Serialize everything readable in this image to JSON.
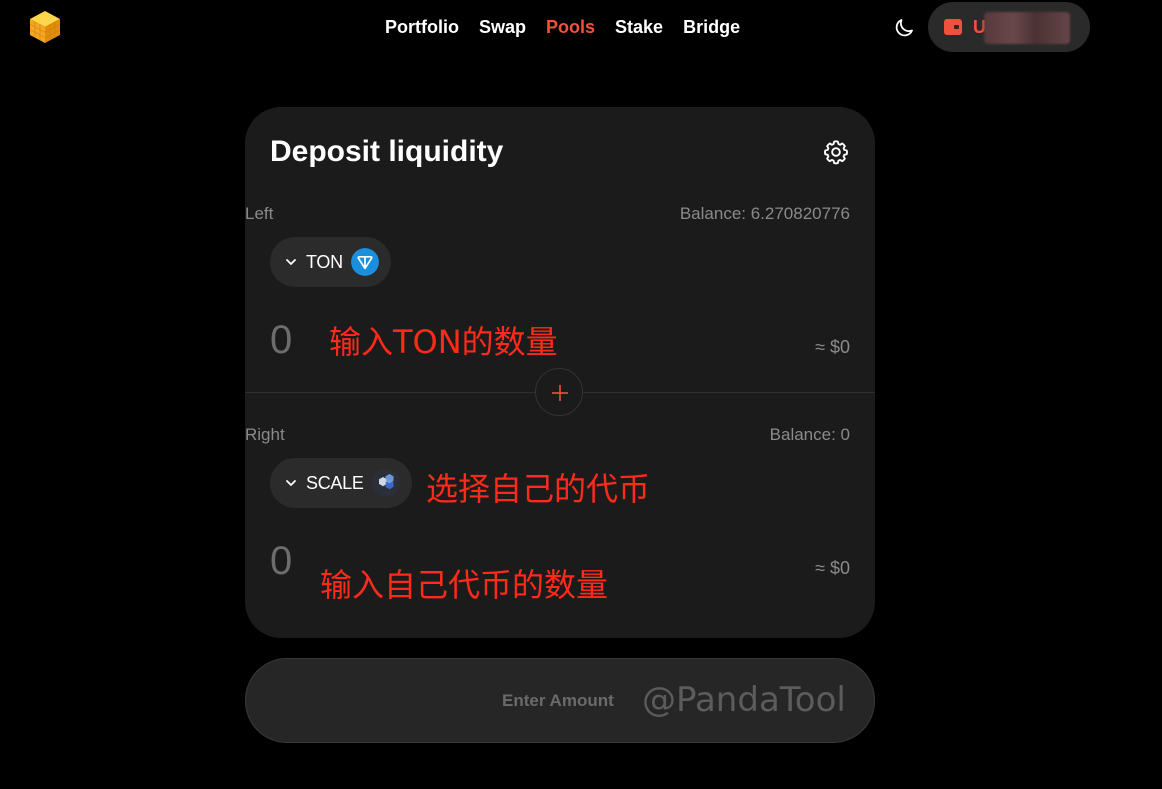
{
  "header": {
    "nav": [
      {
        "label": "Portfolio",
        "active": false
      },
      {
        "label": "Swap",
        "active": false
      },
      {
        "label": "Pools",
        "active": true
      },
      {
        "label": "Stake",
        "active": false
      },
      {
        "label": "Bridge",
        "active": false
      }
    ],
    "wallet_label": "U",
    "icons": {
      "logo": "cube-logo-icon",
      "theme": "moon-icon",
      "wallet": "wallet-icon"
    }
  },
  "card": {
    "title": "Deposit liquidity",
    "left": {
      "label": "Left",
      "balance": "Balance: 6.270820776",
      "token": "TON",
      "amount_placeholder": "0",
      "usd": "≈ $0",
      "annotation": "输入TON的数量"
    },
    "right": {
      "label": "Right",
      "balance": "Balance: 0",
      "token": "SCALE",
      "amount_placeholder": "0",
      "usd": "≈ $0",
      "annotation_select": "选择自己的代币",
      "annotation_amount": "输入自己代币的数量"
    }
  },
  "submit": {
    "label": "Enter Amount",
    "watermark": "@PandaTool"
  },
  "colors": {
    "accent": "#f0513c",
    "background": "#000000",
    "card": "#1b1b1b",
    "annotation": "#ff2a1a",
    "ton": "#1a8fdd"
  }
}
